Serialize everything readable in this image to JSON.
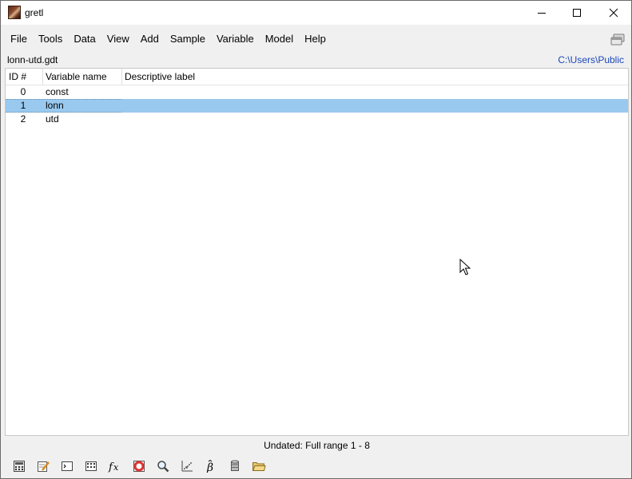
{
  "window": {
    "title": "gretl",
    "minimize_icon": "minimize-icon",
    "maximize_icon": "maximize-icon",
    "close_icon": "close-icon"
  },
  "menubar": {
    "items": [
      "File",
      "Tools",
      "Data",
      "View",
      "Add",
      "Sample",
      "Variable",
      "Model",
      "Help"
    ],
    "right_icon": "windows-list-icon"
  },
  "info": {
    "filename": "lonn-utd.gdt",
    "workdir": "C:\\Users\\Public"
  },
  "list": {
    "columns": [
      "ID #",
      "Variable name",
      "Descriptive label"
    ],
    "rows": [
      {
        "id": "0",
        "name": "const",
        "label": ""
      },
      {
        "id": "1",
        "name": "lonn",
        "label": "",
        "selected": true
      },
      {
        "id": "2",
        "name": "utd",
        "label": ""
      }
    ]
  },
  "status": {
    "text": "Undated: Full range 1 - 8"
  },
  "toolbar": {
    "icons": [
      "calculator-icon",
      "edit-script-icon",
      "console-icon",
      "session-icons-icon",
      "function-packages-icon",
      "help-icon",
      "search-icon",
      "plot-icon",
      "model-icon",
      "database-icon",
      "open-folder-icon"
    ]
  },
  "colors": {
    "selection": "#99c9ef",
    "workdir_link": "#1a47b8"
  }
}
